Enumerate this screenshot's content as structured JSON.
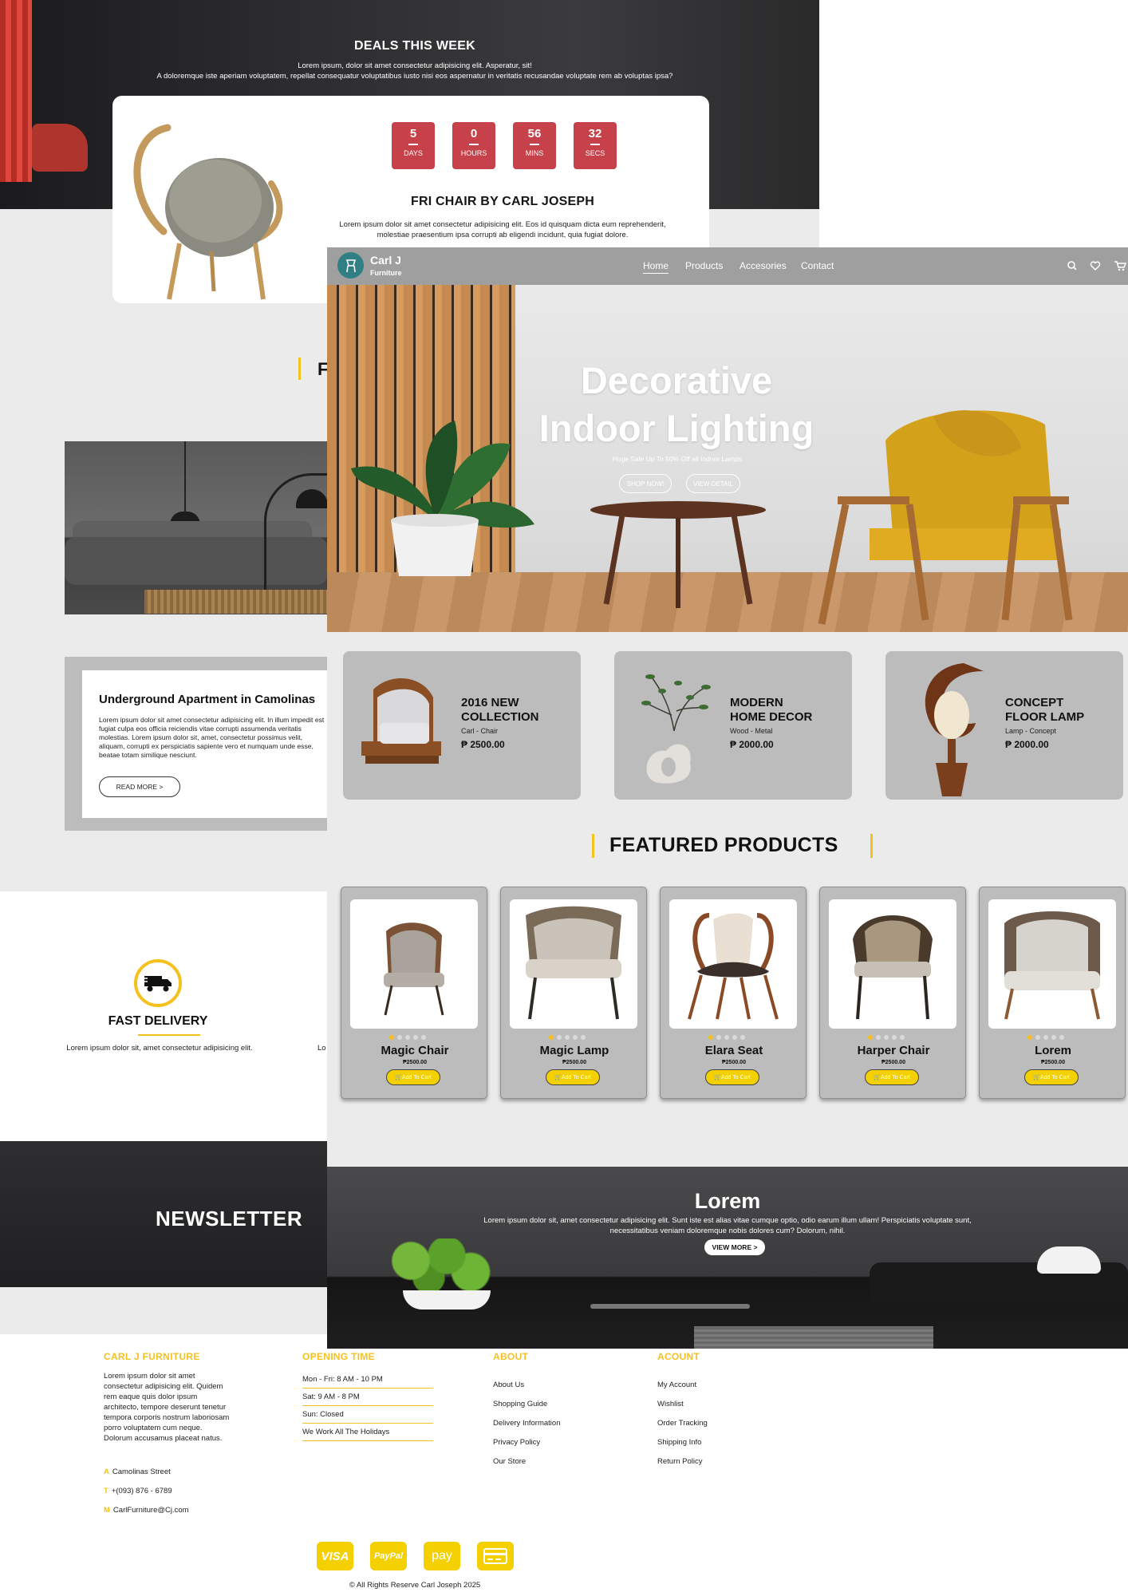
{
  "deals": {
    "title": "DEALS THIS WEEK",
    "subtitle_1": "Lorem ipsum, dolor sit amet consectetur adipisicing elit. Asperatur, sit!",
    "subtitle_2": "A doloremque iste aperiam voluptatem, repellat consequatur voluptatibus iusto nisi eos aspernatur in veritatis recusandae voluptate rem ab voluptas ipsa?",
    "countdown": [
      {
        "value": "5",
        "label": "DAYS"
      },
      {
        "value": "0",
        "label": "HOURS"
      },
      {
        "value": "56",
        "label": "MINS"
      },
      {
        "value": "32",
        "label": "SECS"
      }
    ],
    "product_name": "FRI CHAIR BY CARL JOSEPH",
    "product_desc": "Lorem ipsum dolor sit amet consectetur adipisicing elit. Eos id quisquam dicta eum reprehenderit, molestiae praesentium ipsa corrupti ab eligendi incidunt, quia fugiat dolore."
  },
  "back_page": {
    "section_letter": "F",
    "article": {
      "title": "Underground Apartment in Camolinas",
      "body": "Lorem ipsum dolor sit amet consectetur adipisicing elit. In illum impedit est fugiat culpa eos officia reiciendis vitae corrupti assumenda veritatis molestias. Lorem ipsum dolor sit, amet, consectetur possimus velit, aliquam, corrupti ex perspiciatis sapiente vero et numquam unde esse, beatae totam similique nesciunt.",
      "read_more": "READ MORE >"
    },
    "fast_delivery": {
      "title": "FAST DELIVERY",
      "desc": "Lorem ipsum dolor sit, amet consectetur adipisicing elit.",
      "cut_text": "Lo"
    },
    "newsletter": "NEWSLETTER"
  },
  "nav": {
    "brand": "Carl J",
    "brand_sub": "Furniture",
    "links": [
      "Home",
      "Products",
      "Accesories",
      "Contact"
    ],
    "icons": [
      "search-icon",
      "heart-icon",
      "cart-icon"
    ]
  },
  "hero": {
    "title_line1": "Decorative",
    "title_line2": "Indoor Lighting",
    "subtitle": "Huge Sale Up To 50% Off all Indoor Lamps.",
    "btn_shop": "SHOP NOW!",
    "btn_detail": "VIEW DETAIL"
  },
  "categories": [
    {
      "title_1": "2016 NEW",
      "title_2": "COLLECTION",
      "meta": "Carl - Chair",
      "price": "₱ 2500.00"
    },
    {
      "title_1": "MODERN",
      "title_2": "HOME DECOR",
      "meta": "Wood - Metal",
      "price": "₱ 2000.00"
    },
    {
      "title_1": "CONCEPT",
      "title_2": "FLOOR LAMP",
      "meta": "Lamp - Concept",
      "price": "₱ 2000.00"
    }
  ],
  "featured": {
    "title": "FEATURED PRODUCTS",
    "products": [
      {
        "name": "Magic Chair",
        "price": "₱2500.00",
        "cta": "Add To Cart",
        "rating": 1
      },
      {
        "name": "Magic Lamp",
        "price": "₱2500.00",
        "cta": "Add To Cart",
        "rating": 1
      },
      {
        "name": "Elara Seat",
        "price": "₱2500.00",
        "cta": "Add To Cart",
        "rating": 1
      },
      {
        "name": "Harper Chair",
        "price": "₱2500.00",
        "cta": "Add To Cart",
        "rating": 1
      },
      {
        "name": "Lorem",
        "price": "₱2500.00",
        "cta": "Add To Cart",
        "rating": 1
      }
    ]
  },
  "promo": {
    "title": "Lorem",
    "desc": "Lorem ipsum dolor sit, amet consectetur adipisicing elit. Sunt iste est alias vitae cumque optio, odio earum illum ullam! Perspiciatis voluptate sunt, necessitatibus veniam doloremque nobis dolores cum? Dolorum, nihil.",
    "cta": "VIEW MORE >"
  },
  "footer": {
    "brand_head": "CARL J FURNITURE",
    "brand_text": "Lorem ipsum dolor sit amet consectetur adipisicing elit. Quidem rem eaque quis dolor ipsum architecto, tempore deserunt tenetur tempora corporis nostrum laboriosam porro voluptatem cum neque. Dolorum accusamus placeat natus.",
    "address_key": "A",
    "address": "Camolinas Street",
    "phone_key": "T",
    "phone": "+(093) 876 - 6789",
    "mail_key": "M",
    "mail": "CarlFurniture@Cj.com",
    "hours_head": "OPENING TIME",
    "hours": [
      "Mon - Fri: 8 AM - 10 PM",
      "Sat: 9 AM - 8 PM",
      "Sun: Closed",
      "We Work All The Holidays"
    ],
    "about_head": "ABOUT",
    "about": [
      "About Us",
      "Shopping Guide",
      "Delivery Information",
      "Privacy Policy",
      "Our Store"
    ],
    "account_head": "ACOUNT",
    "account": [
      "My Account",
      "Wishlist",
      "Order Tracking",
      "Shipping Info",
      "Return Policy"
    ],
    "payments": [
      "VISA",
      "PayPal",
      "pay"
    ],
    "copyright": "© All Rights Reserve Carl Joseph 2025"
  },
  "colors": {
    "accent": "#f4c21f",
    "countdown": "#c7414a",
    "card_gray": "#bdbcbc",
    "nav_gray": "#a09f9f"
  }
}
